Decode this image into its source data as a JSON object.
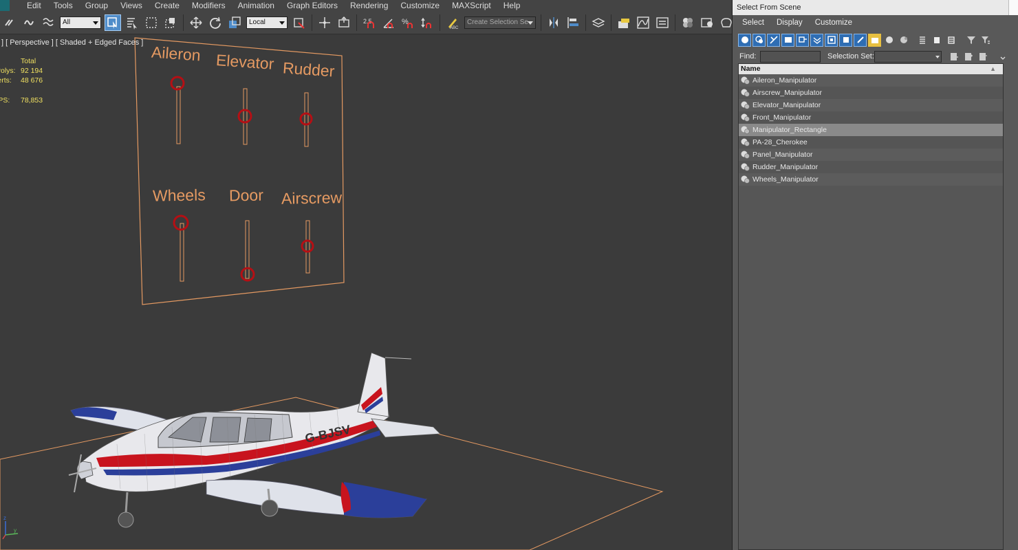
{
  "menu": {
    "items": [
      "Edit",
      "Tools",
      "Group",
      "Views",
      "Create",
      "Modifiers",
      "Animation",
      "Graph Editors",
      "Rendering",
      "Customize",
      "MAXScript",
      "Help"
    ]
  },
  "toolbar": {
    "filter_value": "All",
    "coord_value": "Local",
    "snap_value": "2.5",
    "selection_set_placeholder": "Create Selection Se"
  },
  "viewport": {
    "label": "] [ Perspective ] [ Shaded + Edged Faces ]",
    "stats": {
      "header": "Total",
      "polys_label": "Polys:",
      "polys_value": "92 194",
      "verts_label": "Verts:",
      "verts_value": "48 676",
      "fps_label": "FPS:",
      "fps_value": "78,853"
    },
    "panel_labels": [
      "Aileron",
      "Elevator",
      "Rudder",
      "Wheels",
      "Door",
      "Airscrew"
    ],
    "registration": "G-BJSV",
    "colors": {
      "panel_orange": "#e59a62",
      "manipulator_red": "#b50f14",
      "stats_yellow": "#f0e060"
    }
  },
  "select_from_scene": {
    "title": "Select From Scene",
    "menus": [
      "Select",
      "Display",
      "Customize"
    ],
    "find_label": "Find:",
    "selection_set_label": "Selection Set:",
    "column_name": "Name",
    "rows": [
      {
        "name": "Aileron_Manipulator",
        "selected": false
      },
      {
        "name": "Airscrew_Manipulator",
        "selected": false
      },
      {
        "name": "Elevator_Manipulator",
        "selected": false
      },
      {
        "name": "Front_Manipulator",
        "selected": false
      },
      {
        "name": "Manipulator_Rectangle",
        "selected": true
      },
      {
        "name": "PA-28_Cherokee",
        "selected": false
      },
      {
        "name": "Panel_Manipulator",
        "selected": false
      },
      {
        "name": "Rudder_Manipulator",
        "selected": false
      },
      {
        "name": "Wheels_Manipulator",
        "selected": false
      }
    ]
  }
}
